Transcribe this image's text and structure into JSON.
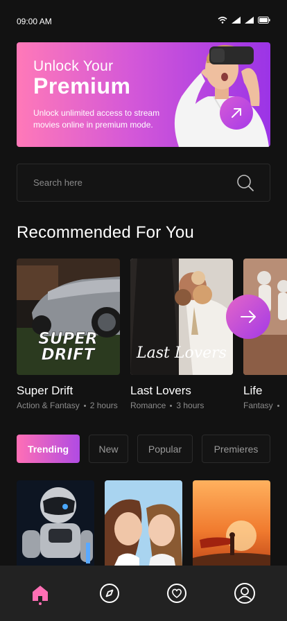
{
  "status_bar": {
    "time": "09:00 AM"
  },
  "banner": {
    "line1": "Unlock Your",
    "line2": "Premium",
    "description": "Unlock unlimited access to stream movies online in premium mode.",
    "accent_start": "#ff79b8",
    "accent_end": "#9b34e6",
    "cta_icon": "arrow-up-right-icon"
  },
  "search": {
    "placeholder": "Search here",
    "value": "",
    "icon": "search-icon"
  },
  "recommended": {
    "title": "Recommended For You",
    "items": [
      {
        "title": "Super Drift",
        "poster_text_line1": "SUPER",
        "poster_text_line2": "DRIFT",
        "genre": "Action & Fantasy",
        "duration": "2 hours"
      },
      {
        "title": "Last Lovers",
        "poster_text_line1": "Last Lovers",
        "genre": "Romance",
        "duration": "3 hours"
      },
      {
        "title": "Life",
        "genre": "Fantasy"
      }
    ],
    "next_icon": "arrow-right-icon"
  },
  "tabs": [
    {
      "label": "Trending",
      "active": true
    },
    {
      "label": "New",
      "active": false
    },
    {
      "label": "Popular",
      "active": false
    },
    {
      "label": "Premieres",
      "active": false
    }
  ],
  "bottom_nav": [
    {
      "icon": "home-icon",
      "active": true
    },
    {
      "icon": "compass-icon",
      "active": false
    },
    {
      "icon": "heart-icon",
      "active": false
    },
    {
      "icon": "profile-icon",
      "active": false
    }
  ],
  "colors": {
    "background": "#121212",
    "accent_pink": "#ff6fb5",
    "accent_purple": "#a33ae6",
    "nav_bg": "#222222"
  }
}
